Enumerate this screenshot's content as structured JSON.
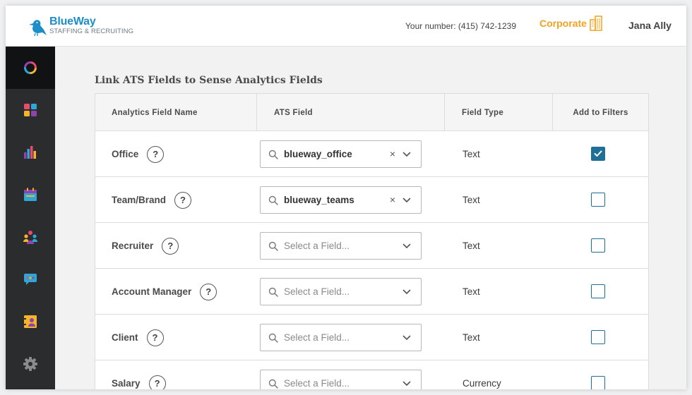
{
  "header": {
    "logo_name": "BlueWay",
    "logo_sub": "STAFFING & RECRUITING",
    "phone_text": "Your number: (415) 742-1239",
    "corporate_label": "Corporate",
    "user_name": "Jana Ally"
  },
  "sidebar": {
    "items": [
      {
        "icon": "ring-chart-icon",
        "active": true
      },
      {
        "icon": "dashboard-tiles-icon",
        "active": false
      },
      {
        "icon": "bar-chart-icon",
        "active": false
      },
      {
        "icon": "calendar-icon",
        "active": false
      },
      {
        "icon": "people-group-icon",
        "active": false
      },
      {
        "icon": "chat-bubble-icon",
        "active": false
      },
      {
        "icon": "contact-card-icon",
        "active": false
      },
      {
        "icon": "gear-icon",
        "active": false
      }
    ]
  },
  "page": {
    "title": "Link ATS Fields to Sense Analytics Fields"
  },
  "table": {
    "headers": {
      "analytics_field_name": "Analytics Field Name",
      "ats_field": "ATS Field",
      "field_type": "Field Type",
      "add_to_filters": "Add to Filters"
    },
    "help_glyph": "?",
    "clear_glyph": "×",
    "rows": [
      {
        "name": "Office",
        "ats_value": "blueway_office",
        "placeholder": "",
        "type": "Text",
        "checked": true
      },
      {
        "name": "Team/Brand",
        "ats_value": "blueway_teams",
        "placeholder": "",
        "type": "Text",
        "checked": false
      },
      {
        "name": "Recruiter",
        "ats_value": "",
        "placeholder": "Select a Field...",
        "type": "Text",
        "checked": false
      },
      {
        "name": "Account Manager",
        "ats_value": "",
        "placeholder": "Select a Field...",
        "type": "Text",
        "checked": false
      },
      {
        "name": "Client",
        "ats_value": "",
        "placeholder": "Select a Field...",
        "type": "Text",
        "checked": false
      },
      {
        "name": "Salary",
        "ats_value": "",
        "placeholder": "Select a Field...",
        "type": "Currency",
        "checked": false
      }
    ]
  },
  "colors": {
    "brand_blue": "#1d8ec7",
    "corporate_orange": "#f0a31f",
    "checkbox_blue": "#1f6f96",
    "sidebar_bg": "#2b2c2e"
  }
}
